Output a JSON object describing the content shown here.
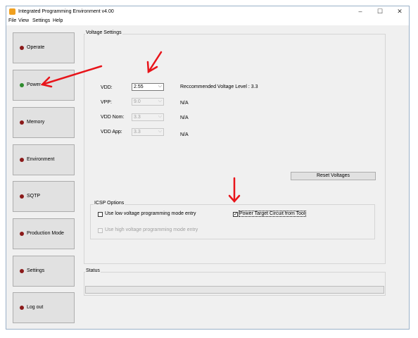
{
  "window": {
    "title": "Integrated Programming Environment v4.00",
    "controls": {
      "minimize": "–",
      "maximize": "☐",
      "close": "✕"
    }
  },
  "menu": [
    "File",
    "View",
    "Settings",
    "Help"
  ],
  "nav": [
    {
      "label": "Operate",
      "status": "red"
    },
    {
      "label": "Power",
      "status": "green"
    },
    {
      "label": "Memory",
      "status": "red"
    },
    {
      "label": "Environment",
      "status": "red"
    },
    {
      "label": "SQTP",
      "status": "red"
    },
    {
      "label": "Production Mode",
      "status": "red"
    },
    {
      "label": "Settings",
      "status": "red"
    },
    {
      "label": "Log out",
      "status": "red"
    }
  ],
  "voltage_settings": {
    "title": "Voltage Settings",
    "vdd": {
      "label": "VDD:",
      "value": "2.55",
      "info": "Reccommended Voltage Level : 3.3"
    },
    "vpp": {
      "label": "VPP:",
      "value": "9.0",
      "info": "N/A"
    },
    "vdd_nom": {
      "label": "VDD Nom:",
      "value": "3.3",
      "info": "N/A"
    },
    "vdd_app": {
      "label": "VDD App:",
      "value": "3.3",
      "info": "N/A"
    },
    "reset_button": "Reset Voltages"
  },
  "icsp": {
    "title": "ICSP Options",
    "low_voltage": {
      "label": "Use low voltage programming mode entry",
      "checked": false
    },
    "power_target": {
      "label": "Power Target Circuit from Tool",
      "checked": true,
      "mark": "✓"
    },
    "high_voltage": {
      "label": "Use high voltage programming mode entry",
      "checked": false
    }
  },
  "status": {
    "title": "Status",
    "progress": 0
  },
  "colors": {
    "status_red": "#8b1a1a",
    "status_green": "#2e8b2e",
    "annotation_arrow": "#e8141a"
  },
  "icons": {
    "app": "app-icon",
    "combo_arrow": "⌵"
  }
}
